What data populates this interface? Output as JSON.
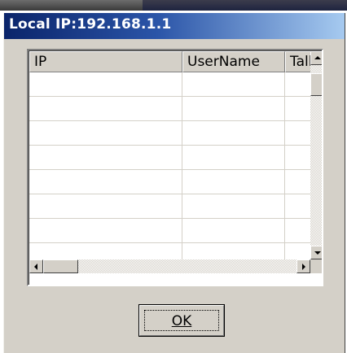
{
  "window": {
    "title": "Local IP:192.168.1.1"
  },
  "list": {
    "columns": [
      {
        "label": "IP"
      },
      {
        "label": "UserName"
      },
      {
        "label": "Tall"
      }
    ],
    "rows": [
      [
        "",
        "",
        ""
      ],
      [
        "",
        "",
        ""
      ],
      [
        "",
        "",
        ""
      ],
      [
        "",
        "",
        ""
      ],
      [
        "",
        "",
        ""
      ],
      [
        "",
        "",
        ""
      ],
      [
        "",
        "",
        ""
      ],
      [
        "",
        "",
        ""
      ]
    ]
  },
  "buttons": {
    "ok_label": "OK"
  },
  "icons": {
    "scroll_up": "arrow-up-icon",
    "scroll_down": "arrow-down-icon",
    "scroll_left": "arrow-left-icon",
    "scroll_right": "arrow-right-icon"
  },
  "colors": {
    "title_start": "#0a246a",
    "title_end": "#a6caf0",
    "face": "#d4d0c8"
  }
}
